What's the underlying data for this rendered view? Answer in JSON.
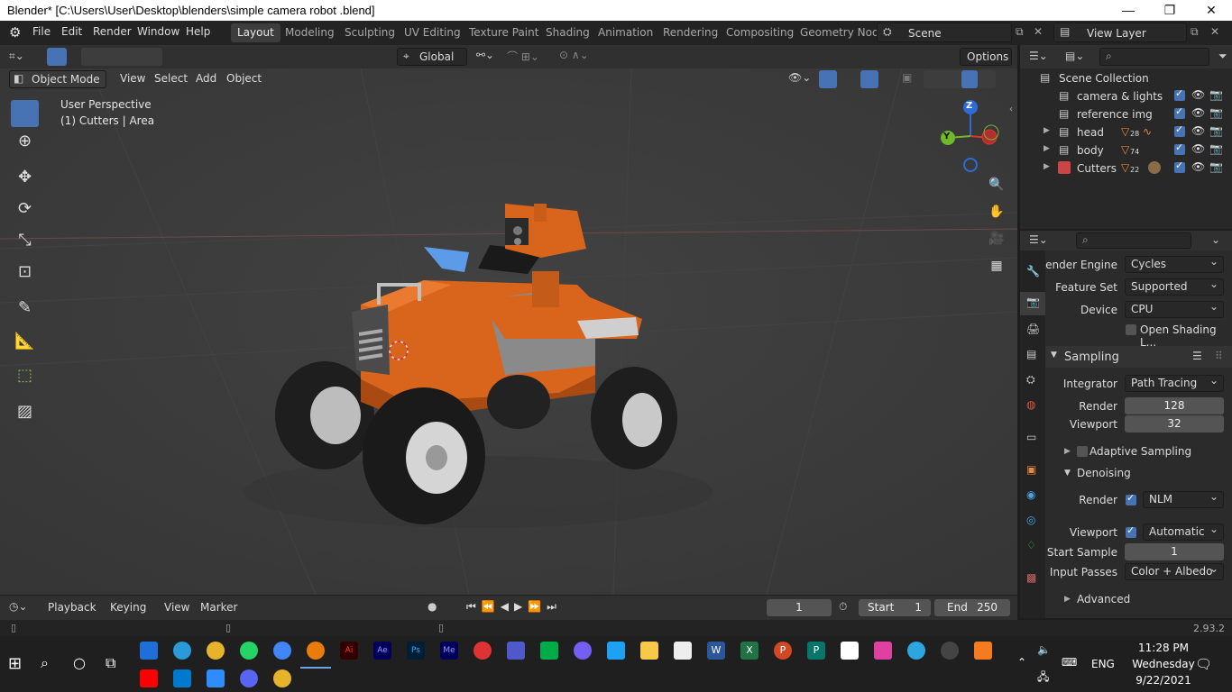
{
  "window": {
    "title": "Blender* [C:\\Users\\User\\Desktop\\blenders\\simple camera robot .blend]",
    "minimize": "—",
    "maximize": "❐",
    "close": "✕"
  },
  "menu": [
    "File",
    "Edit",
    "Render",
    "Window",
    "Help"
  ],
  "workspaces": [
    "Layout",
    "Modeling",
    "Sculpting",
    "UV Editing",
    "Texture Paint",
    "Shading",
    "Animation",
    "Rendering",
    "Compositing",
    "Geometry Nod"
  ],
  "active_workspace": "Layout",
  "scene": {
    "name": "Scene",
    "view_layer": "View Layer"
  },
  "toolbar": {
    "orientation": "Global",
    "options": "Options"
  },
  "viewport": {
    "mode": "Object Mode",
    "menus": [
      "View",
      "Select",
      "Add",
      "Object"
    ],
    "info_line1": "User Perspective",
    "info_line2": "(1) Cutters | Area",
    "gizmo": {
      "z": "Z",
      "y": "Y"
    }
  },
  "outliner": {
    "root": "Scene Collection",
    "items": [
      {
        "name": "camera & lights",
        "badge": ""
      },
      {
        "name": "reference img",
        "badge": ""
      },
      {
        "name": "head",
        "badge": "28"
      },
      {
        "name": "body",
        "badge": "74"
      },
      {
        "name": "Cutters",
        "badge": "22"
      }
    ]
  },
  "properties": {
    "render_engine_label": "Render Engine",
    "render_engine": "Cycles",
    "feature_set_label": "Feature Set",
    "feature_set": "Supported",
    "device_label": "Device",
    "device": "CPU",
    "osl_label": "Open Shading L...",
    "sampling": "Sampling",
    "integrator_label": "Integrator",
    "integrator": "Path Tracing",
    "render_label": "Render",
    "render_samples": "128",
    "viewport_label": "Viewport",
    "viewport_samples": "32",
    "adaptive": "Adaptive Sampling",
    "denoising": "Denoising",
    "den_render_label": "Render",
    "den_render": "NLM",
    "den_viewport_label": "Viewport",
    "den_viewport": "Automatic",
    "start_sample_label": "Start Sample",
    "start_sample": "1",
    "input_passes_label": "Input Passes",
    "input_passes": "Color + Albedo",
    "advanced": "Advanced"
  },
  "timeline": {
    "menus": [
      "Playback",
      "Keying",
      "View",
      "Marker"
    ],
    "current": "1",
    "start_label": "Start",
    "start": "1",
    "end_label": "End",
    "end": "250"
  },
  "status": {
    "version": "2.93.2"
  },
  "taskbar": {
    "time": "11:28 PM",
    "day": "Wednesday",
    "date": "9/22/2021",
    "lang": "ENG"
  },
  "colors": {
    "accent": "#4772b3",
    "robot_orange": "#d9641c",
    "viewport_bg": "#3c3c3c"
  }
}
